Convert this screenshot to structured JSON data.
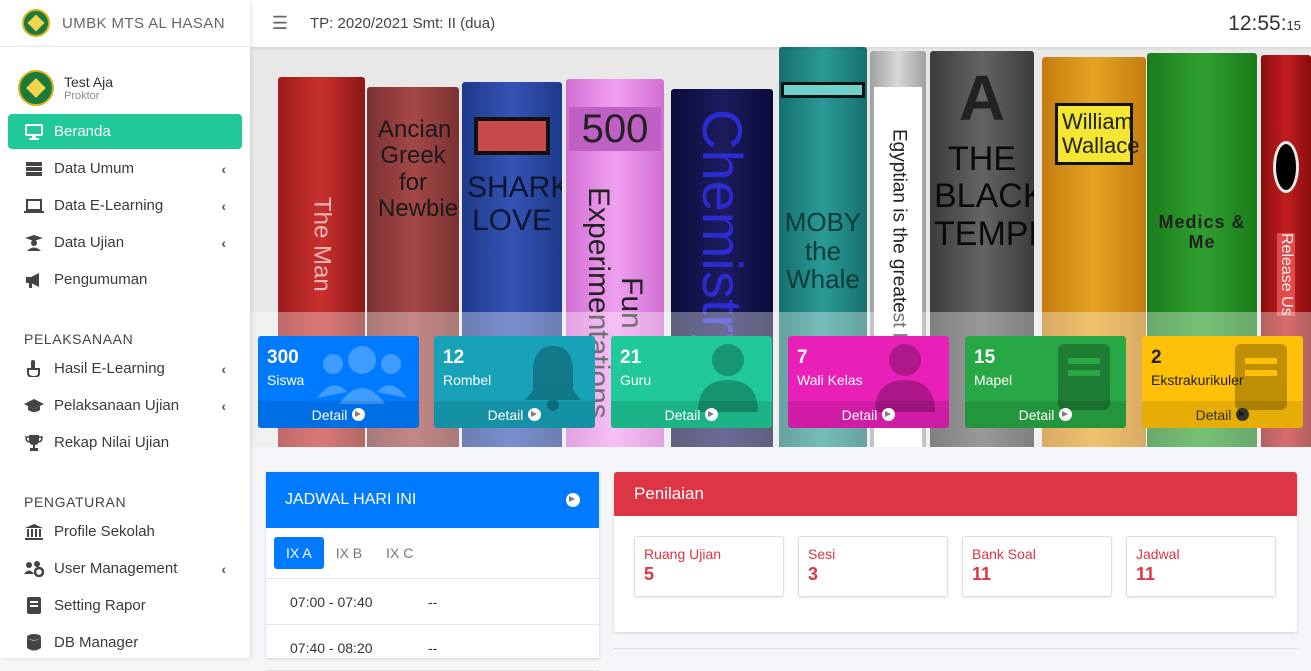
{
  "brand": {
    "name": "UMBK MTS AL HASAN"
  },
  "user": {
    "name": "Test Aja",
    "role": "Proktor"
  },
  "menu": [
    {
      "label": "Beranda",
      "icon": "desktop-icon",
      "active": true,
      "has_children": false
    },
    {
      "label": "Data Umum",
      "icon": "server-icon",
      "has_children": true
    },
    {
      "label": "Data E-Learning",
      "icon": "laptop-icon",
      "has_children": true
    },
    {
      "label": "Data Ujian",
      "icon": "user-graduate-icon",
      "has_children": true
    },
    {
      "label": "Pengumuman",
      "icon": "megaphone-icon",
      "has_children": false
    }
  ],
  "sections": {
    "pelaksanaan": "PELAKSANAAN",
    "pengaturan": "PENGATURAN"
  },
  "menu_pelaksanaan": [
    {
      "label": "Hasil E-Learning",
      "icon": "hand-icon",
      "has_children": true
    },
    {
      "label": "Pelaksanaan Ujian",
      "icon": "graduation-cap-icon",
      "has_children": true
    },
    {
      "label": "Rekap Nilai Ujian",
      "icon": "trophy-icon",
      "has_children": false
    }
  ],
  "menu_pengaturan": [
    {
      "label": "Profile Sekolah",
      "icon": "bank-icon",
      "has_children": false
    },
    {
      "label": "User Management",
      "icon": "users-cog-icon",
      "has_children": true
    },
    {
      "label": "Setting Rapor",
      "icon": "book-icon",
      "has_children": false
    },
    {
      "label": "DB Manager",
      "icon": "database-icon",
      "has_children": false
    }
  ],
  "topbar": {
    "period": "TP: 2020/2021 Smt: II (dua)",
    "clock_main": "12:55:",
    "clock_sec": "15"
  },
  "books": [
    "The Man",
    "Ancian Greek for Newbies",
    "SHARKS LOVE",
    "500",
    "Fun Experimentations",
    "Chemistry",
    "MOBY the Whale",
    "Egyptian is the greatest language",
    "THE BLACK TEMPLE",
    "William Wallace",
    "Medics & Me",
    "Release Us"
  ],
  "stats": [
    {
      "num": "300",
      "label": "Siswa",
      "detail": "Detail",
      "color": "#007bff",
      "icon": "users-icon"
    },
    {
      "num": "12",
      "label": "Rombel",
      "detail": "Detail",
      "color": "#17a2b8",
      "icon": "bell-icon"
    },
    {
      "num": "21",
      "label": "Guru",
      "detail": "Detail",
      "color": "#20c997",
      "icon": "user-icon"
    },
    {
      "num": "7",
      "label": "Wali Kelas",
      "detail": "Detail",
      "color": "#e83e8c",
      "icon": "user-icon"
    },
    {
      "num": "15",
      "label": "Mapel",
      "detail": "Detail",
      "color": "#28a745",
      "icon": "book-icon"
    },
    {
      "num": "2",
      "label": "Ekstrakurikuler",
      "detail": "Detail",
      "color": "#ffc107",
      "icon": "book-icon"
    }
  ],
  "jadwal": {
    "title": "JADWAL HARI INI",
    "tabs": [
      "IX A",
      "IX B",
      "IX C"
    ],
    "rows": [
      {
        "time": "07:00 - 07:40",
        "value": "--"
      },
      {
        "time": "07:40 - 08:20",
        "value": "--"
      }
    ]
  },
  "penilaian": {
    "title": "Penilaian",
    "items": [
      {
        "label": "Ruang Ujian",
        "value": "5"
      },
      {
        "label": "Sesi",
        "value": "3"
      },
      {
        "label": "Bank Soal",
        "value": "11"
      },
      {
        "label": "Jadwal",
        "value": "11"
      }
    ]
  }
}
